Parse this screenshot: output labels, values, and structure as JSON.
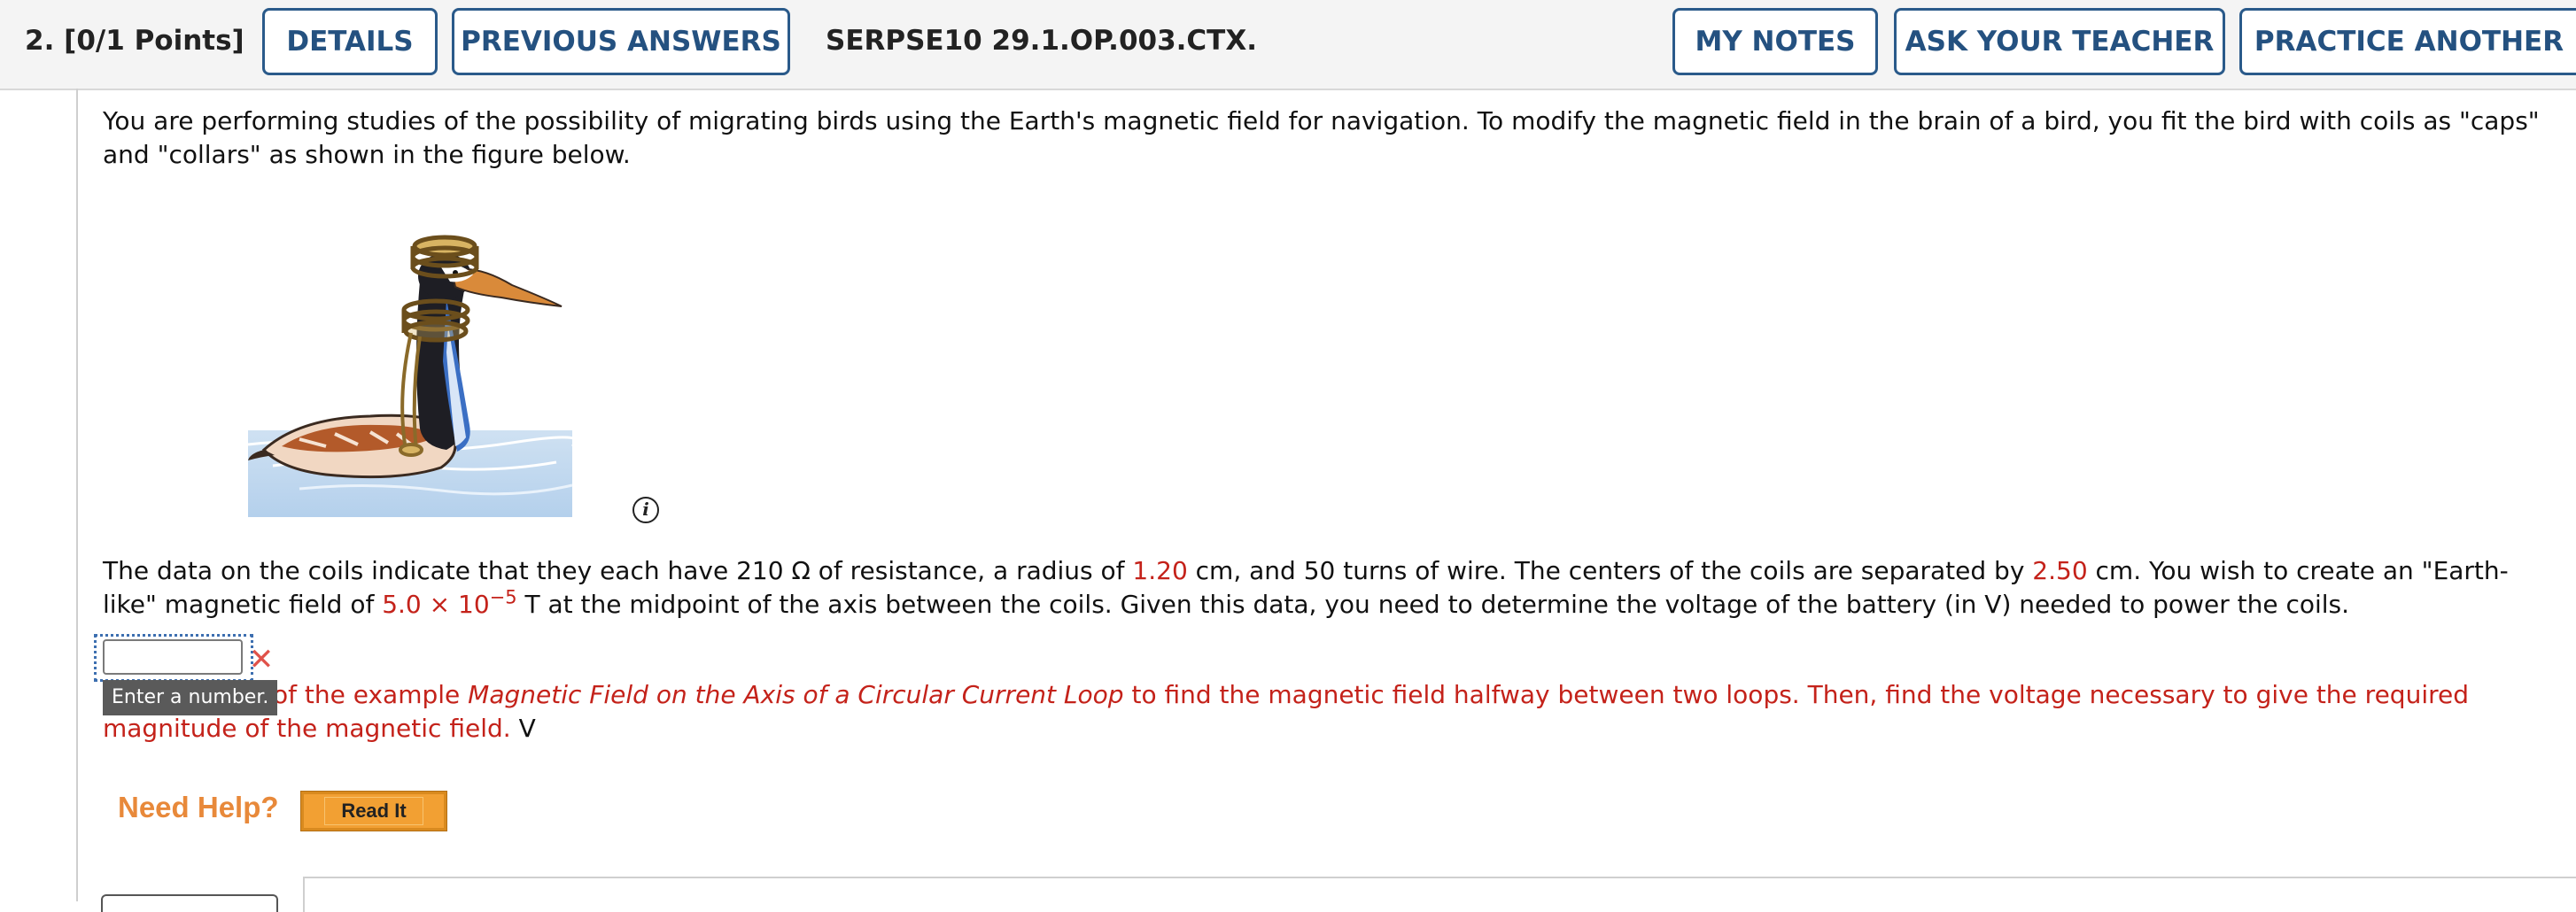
{
  "header": {
    "question_number": "2.",
    "points": "[0/1 Points]",
    "details_label": "DETAILS",
    "previous_answers_label": "PREVIOUS ANSWERS",
    "question_code": "SERPSE10 29.1.OP.003.CTX.",
    "my_notes_label": "MY NOTES",
    "ask_teacher_label": "ASK YOUR TEACHER",
    "practice_another_label": "PRACTICE ANOTHER"
  },
  "intro": {
    "text": "You are performing studies of the possibility of migrating birds using the Earth's magnetic field for navigation. To modify the magnetic field in the brain of a bird, you fit the bird with coils as \"caps\" and \"collars\" as shown in the figure below."
  },
  "figure": {
    "info_icon_glyph": "i"
  },
  "problem": {
    "part1": "The data on the coils indicate that they each have 210 Ω of resistance, a radius of ",
    "radius": "1.20",
    "part2": " cm, and 50 turns of wire. The centers of the coils are separated by ",
    "separation": "2.50",
    "part3": " cm. You wish to create an \"Earth-like\" magnetic field of ",
    "field_mantissa": "5.0 × 10",
    "field_exponent": "−5",
    "part4": " T at the midpoint of the axis between the coils. Given this data, you need to determine the voltage of the battery (in V) needed to power the coils."
  },
  "answer": {
    "value": "",
    "status": "incorrect",
    "tooltip": "Enter a number.",
    "unit": "V"
  },
  "hint": {
    "part1": "of the example ",
    "example_title": "Magnetic Field on the Axis of a Circular Current Loop",
    "part2": " to find the magnetic field halfway between two loops. Then, find the voltage necessary to give the required magnitude of the magnetic field."
  },
  "help": {
    "need_help_label": "Need Help?",
    "read_it_label": "Read It"
  },
  "colors": {
    "accent_blue": "#245180",
    "given_value_red": "#c4221a",
    "help_orange": "#e8893a",
    "wrong_mark": "#e0524a"
  }
}
